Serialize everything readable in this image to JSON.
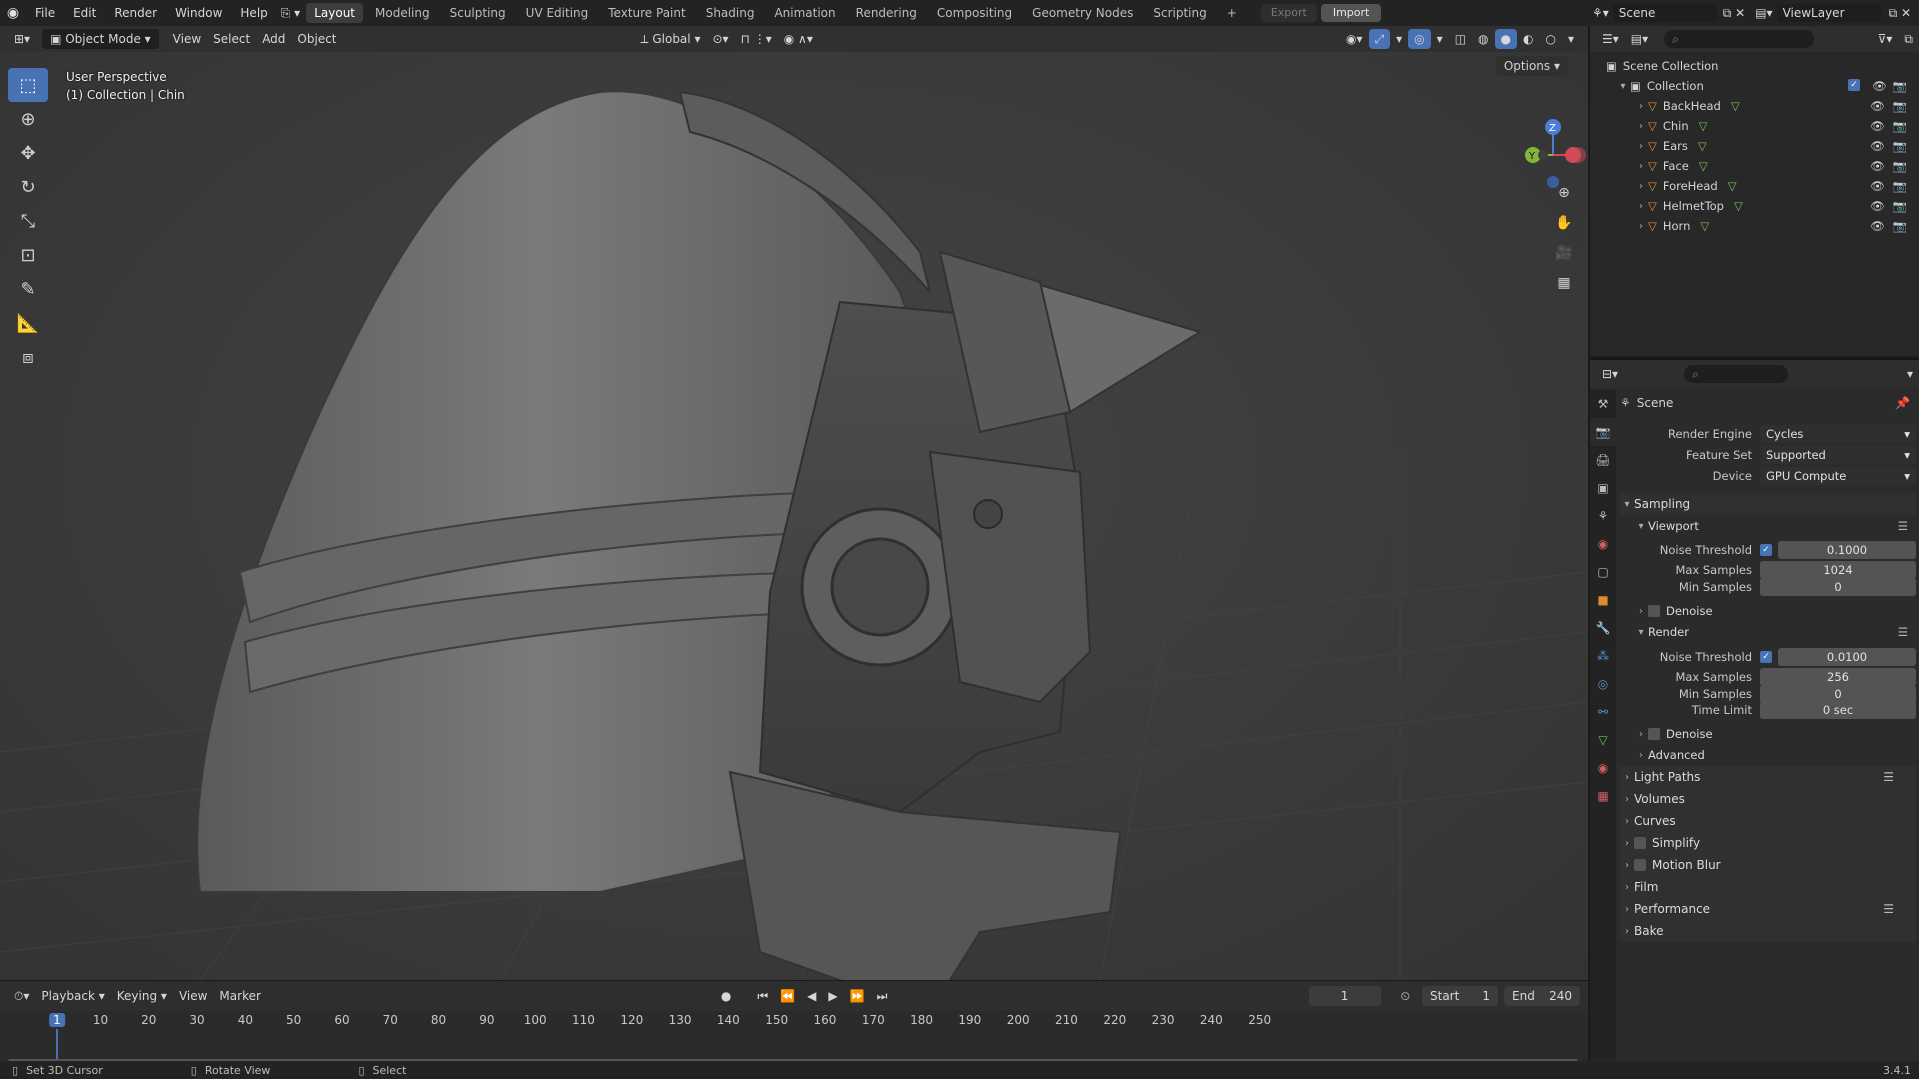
{
  "topbar": {
    "menus": [
      "File",
      "Edit",
      "Render",
      "Window",
      "Help"
    ],
    "workspaces": [
      "Layout",
      "Modeling",
      "Sculpting",
      "UV Editing",
      "Texture Paint",
      "Shading",
      "Animation",
      "Rendering",
      "Compositing",
      "Geometry Nodes",
      "Scripting"
    ],
    "active_workspace": "Layout",
    "add_workspace": "+",
    "export_label": "Export",
    "import_label": "Import",
    "scene_name": "Scene",
    "view_layer": "ViewLayer"
  },
  "viewport_header": {
    "mode": "Object Mode",
    "menus": [
      "View",
      "Select",
      "Add",
      "Object"
    ],
    "orientation": "Global"
  },
  "viewport": {
    "perspective_label": "User Perspective",
    "collection_label": "(1) Collection | Chin",
    "options_label": "Options",
    "gizmo_z": "Z",
    "gizmo_y": "Y",
    "tools": [
      "select-box",
      "cursor",
      "move",
      "rotate",
      "scale",
      "transform",
      "annotate",
      "measure",
      "add-cube"
    ]
  },
  "outliner": {
    "root": "Scene Collection",
    "collection": "Collection",
    "objects": [
      "BackHead",
      "Chin",
      "Ears",
      "Face",
      "ForeHead",
      "HelmetTop",
      "Horn"
    ]
  },
  "properties": {
    "context": "Scene",
    "render_engine_label": "Render Engine",
    "render_engine": "Cycles",
    "feature_set_label": "Feature Set",
    "feature_set": "Supported",
    "device_label": "Device",
    "device": "GPU Compute",
    "sampling": "Sampling",
    "viewport": "Viewport",
    "noise_threshold_label": "Noise Threshold",
    "viewport_noise_threshold": "0.1000",
    "max_samples_label": "Max Samples",
    "viewport_max_samples": "1024",
    "min_samples_label": "Min Samples",
    "viewport_min_samples": "0",
    "denoise": "Denoise",
    "render": "Render",
    "render_noise_threshold": "0.0100",
    "render_max_samples": "256",
    "render_min_samples": "0",
    "time_limit_label": "Time Limit",
    "time_limit": "0 sec",
    "advanced": "Advanced",
    "light_paths": "Light Paths",
    "volumes": "Volumes",
    "curves": "Curves",
    "simplify": "Simplify",
    "motion_blur": "Motion Blur",
    "film": "Film",
    "performance": "Performance",
    "bake": "Bake"
  },
  "timeline": {
    "menus": [
      "Playback",
      "Keying",
      "View",
      "Marker"
    ],
    "current_frame": "1",
    "start_label": "Start",
    "start": "1",
    "end_label": "End",
    "end": "240",
    "ticks": [
      "1",
      "10",
      "20",
      "30",
      "40",
      "50",
      "60",
      "70",
      "80",
      "90",
      "100",
      "110",
      "120",
      "130",
      "140",
      "150",
      "160",
      "170",
      "180",
      "190",
      "200",
      "210",
      "220",
      "230",
      "240",
      "250"
    ]
  },
  "statusbar": {
    "left_action": "Set 3D Cursor",
    "mid_action": "Rotate View",
    "right_action": "Select",
    "version": "3.4.1"
  }
}
